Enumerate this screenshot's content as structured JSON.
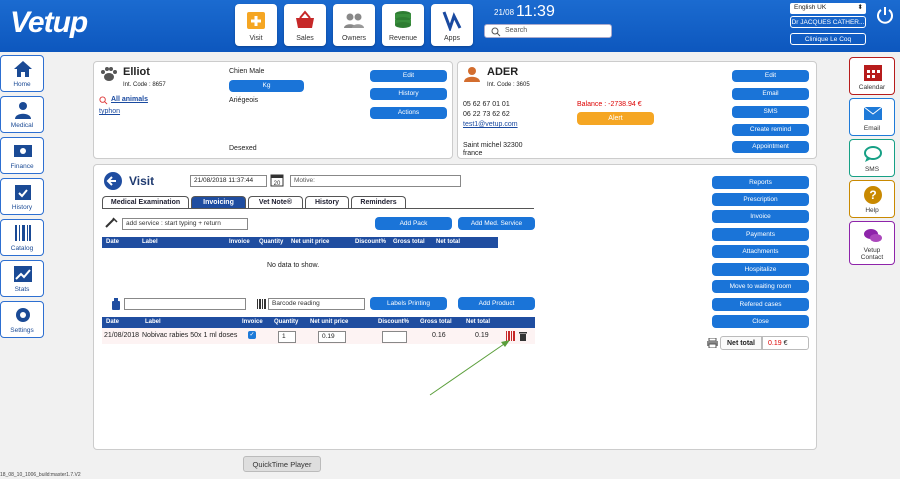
{
  "app": {
    "logo": "Vetup",
    "date": "21/08",
    "time": "11:39",
    "search_placeholder": "Search",
    "language": "English UK",
    "doctor": "Dr JACQUES CATHER...",
    "clinic": "Clinique Le Coq"
  },
  "top_nav": [
    {
      "label": "Visit",
      "icon": "visit-icon"
    },
    {
      "label": "Sales",
      "icon": "basket-icon"
    },
    {
      "label": "Owners",
      "icon": "owners-icon"
    },
    {
      "label": "Revenue",
      "icon": "revenue-icon"
    },
    {
      "label": "Apps",
      "icon": "apps-icon"
    }
  ],
  "left_nav": [
    {
      "label": "Home",
      "icon": "home-icon"
    },
    {
      "label": "Medical",
      "icon": "doctor-icon"
    },
    {
      "label": "Finance",
      "icon": "money-icon"
    },
    {
      "label": "History",
      "icon": "calendar-check-icon"
    },
    {
      "label": "Catalog",
      "icon": "barcode-icon"
    },
    {
      "label": "Stats",
      "icon": "chart-icon"
    },
    {
      "label": "Settings",
      "icon": "gear-icon"
    }
  ],
  "right_nav": [
    {
      "label": "Calendar",
      "icon": "calendar-icon",
      "color": "#b71c1c"
    },
    {
      "label": "Email",
      "icon": "mail-icon",
      "color": "#1e7ad8"
    },
    {
      "label": "SMS",
      "icon": "chat-icon",
      "color": "#16a085"
    },
    {
      "label": "Help",
      "icon": "help-icon",
      "color": "#c98900"
    },
    {
      "label": "Vetup Contact",
      "icon": "contact-icon",
      "color": "#8e24aa"
    }
  ],
  "patient": {
    "name": "Elliot",
    "int_code": "Int. Code : 8657",
    "species": "Chien Male",
    "weight_btn": "Kg",
    "breed": "Ariégeois",
    "all_animals": "All animals",
    "other_animal": "typhon",
    "status": "Desexed",
    "buttons": [
      "Edit",
      "History",
      "Actions"
    ]
  },
  "owner": {
    "name": "ADER",
    "int_code": "Int. Code : 3605",
    "phone1": "05 62 67 01 01",
    "phone2": "06 22 73 62 62",
    "email": "test1@vetup.com",
    "balance": "Balance : -2738.94 €",
    "alert": "Alert",
    "address1": "Saint michel 32300",
    "address2": "france",
    "buttons": [
      "Edit",
      "Email",
      "SMS",
      "Create remind",
      "Appointment"
    ]
  },
  "visit": {
    "title": "Visit",
    "datetime": "21/08/2018 11:37:44",
    "motive_placeholder": "Motive:",
    "tabs": [
      "Medical Examination",
      "Invoicing",
      "Vet Note®",
      "History",
      "Reminders"
    ],
    "active_tab": "Invoicing",
    "service_placeholder": "add service : start typing + return",
    "add_pack": "Add Pack",
    "add_med_service": "Add Med. Service",
    "services_headers": [
      "Date",
      "Label",
      "Invoice",
      "Quantity",
      "Net unit price",
      "Discount%",
      "Gross total",
      "Net total"
    ],
    "no_data": "No data to show.",
    "barcode_placeholder": "Barcode reading",
    "labels_printing": "Labels Printing",
    "add_product": "Add Product",
    "products_headers": [
      "Date",
      "Label",
      "Invoice",
      "Quantity",
      "Net unit price",
      "Discount%",
      "Gross total",
      "Net total"
    ],
    "products_rows": [
      {
        "date": "21/08/2018",
        "label": "Nobivac rabies 50x 1 ml doses",
        "quantity": "1",
        "unit_price": "0.19",
        "discount": "",
        "gross": "0.16",
        "net": "0.19"
      }
    ]
  },
  "actions": [
    "Reports",
    "Prescription",
    "Invoice",
    "Payments",
    "Attachments",
    "Hospitalize",
    "Move to waiting room",
    "Refered cases",
    "Close"
  ],
  "net_total": {
    "label": "Net total",
    "value": "0.19",
    "currency": "€"
  },
  "footer": {
    "version": "18_08_10_1006_build:master1.7.V2",
    "quicktime": "QuickTime Player"
  }
}
